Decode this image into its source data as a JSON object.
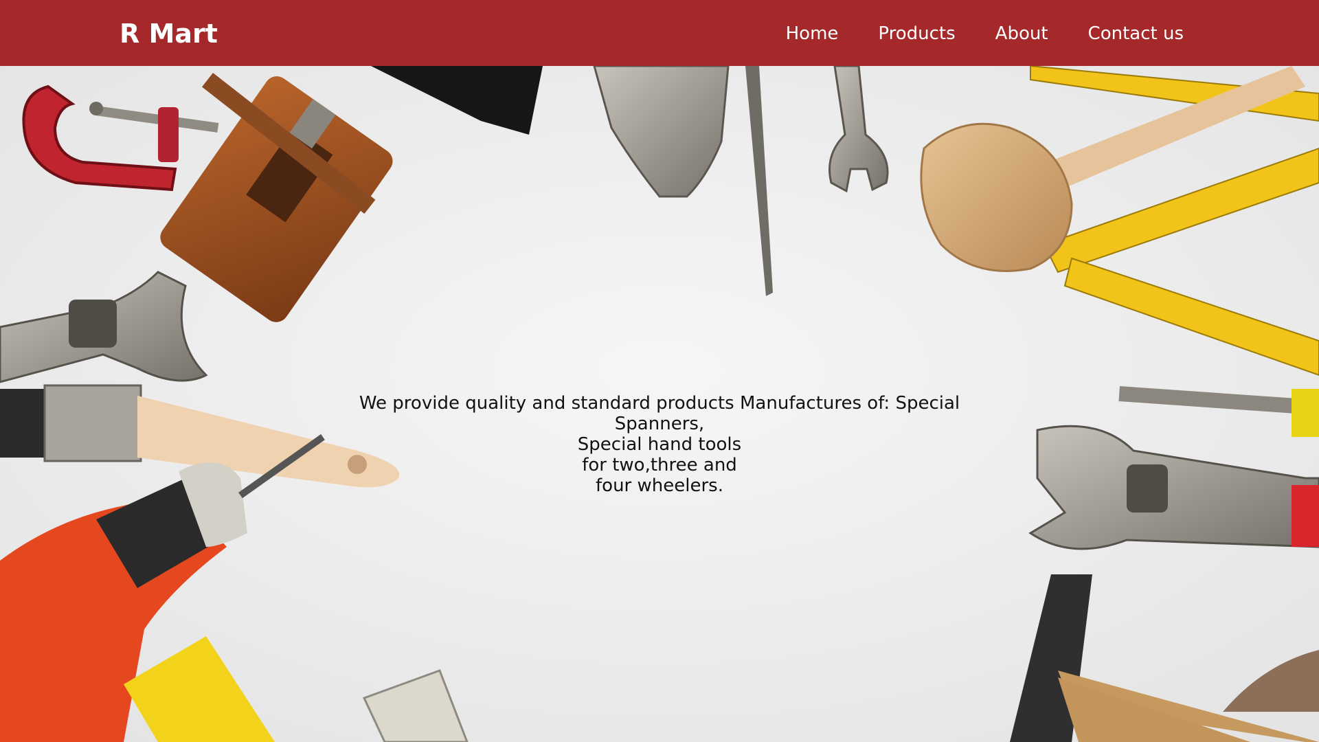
{
  "header": {
    "brand": "R Mart",
    "nav": [
      {
        "label": "Home"
      },
      {
        "label": "Products"
      },
      {
        "label": "About"
      },
      {
        "label": "Contact us"
      }
    ]
  },
  "hero": {
    "tagline_lines": [
      "We provide quality and standard products Manufactures of: Special Spanners,",
      "Special hand tools",
      "for two,three and",
      "four wheelers."
    ],
    "background_image": "flat-lay-hand-tools",
    "tools_depicted": [
      "c-clamp",
      "wood-plane",
      "paint-brush",
      "adjustable-wrench",
      "locking-pliers",
      "screwdriver",
      "spanner",
      "wooden-mallet",
      "folding-ruler",
      "cordless-drill",
      "spirit-level",
      "hammer",
      "pruning-shears"
    ]
  },
  "colors": {
    "header_bg": "#a5282b",
    "header_text": "#ffffff",
    "hero_bg": "#eeeeee",
    "body_text": "#111111"
  }
}
